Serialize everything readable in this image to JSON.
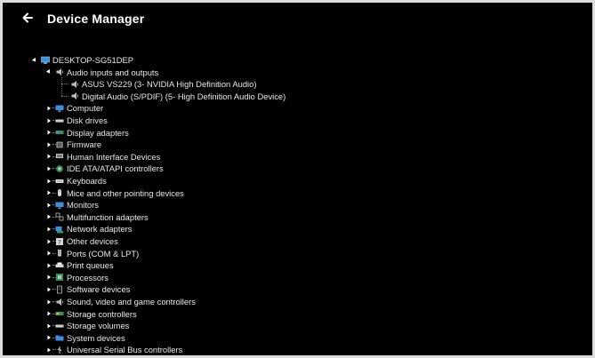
{
  "window": {
    "title": "Device Manager"
  },
  "tree": {
    "root": {
      "label": "DESKTOP-SG51DEP",
      "icon": "computer-icon",
      "expanded": true
    },
    "audio": {
      "label": "Audio inputs and outputs",
      "icon": "speaker-icon",
      "expanded": true,
      "children": [
        {
          "label": "ASUS VS229 (3- NVIDIA High Definition Audio)",
          "icon": "speaker-icon"
        },
        {
          "label": "Digital Audio (S/PDIF) (5- High Definition Audio Device)",
          "icon": "speaker-icon"
        }
      ]
    },
    "categories": [
      {
        "label": "Computer",
        "icon": "monitor-icon"
      },
      {
        "label": "Disk drives",
        "icon": "disk-drive-icon"
      },
      {
        "label": "Display adapters",
        "icon": "display-adapter-icon"
      },
      {
        "label": "Firmware",
        "icon": "firmware-chip-icon"
      },
      {
        "label": "Human Interface Devices",
        "icon": "hid-icon"
      },
      {
        "label": "IDE ATA/ATAPI controllers",
        "icon": "ide-controller-icon"
      },
      {
        "label": "Keyboards",
        "icon": "keyboard-icon"
      },
      {
        "label": "Mice and other pointing devices",
        "icon": "mouse-icon"
      },
      {
        "label": "Monitors",
        "icon": "monitor-icon"
      },
      {
        "label": "Multifunction adapters",
        "icon": "multifunction-adapter-icon"
      },
      {
        "label": "Network adapters",
        "icon": "network-adapter-icon"
      },
      {
        "label": "Other devices",
        "icon": "unknown-device-icon"
      },
      {
        "label": "Ports (COM & LPT)",
        "icon": "port-icon"
      },
      {
        "label": "Print queues",
        "icon": "printer-icon"
      },
      {
        "label": "Processors",
        "icon": "processor-icon"
      },
      {
        "label": "Software devices",
        "icon": "software-device-icon"
      },
      {
        "label": "Sound, video and game controllers",
        "icon": "speaker-icon"
      },
      {
        "label": "Storage controllers",
        "icon": "storage-controller-icon"
      },
      {
        "label": "Storage volumes",
        "icon": "disk-drive-icon"
      },
      {
        "label": "System devices",
        "icon": "system-folder-icon"
      },
      {
        "label": "Universal Serial Bus controllers",
        "icon": "usb-icon"
      }
    ]
  },
  "colors": {
    "background": "#000000",
    "text": "#e8e8e8",
    "accent": "#3a8fe0"
  }
}
